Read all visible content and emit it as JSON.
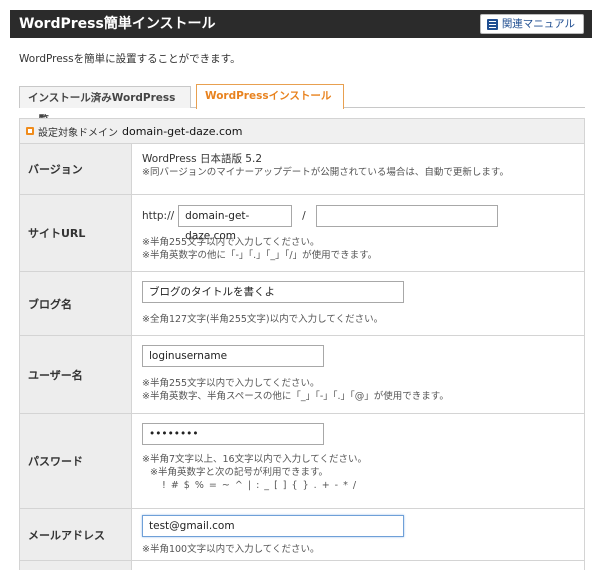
{
  "header": {
    "title": "WordPress簡単インストール",
    "manual_label": "関連マニュアル"
  },
  "lead_text": "WordPressを簡単に設置することができます。",
  "tabs": [
    {
      "label": "インストール済みWordPress一覧",
      "active": false
    },
    {
      "label": "WordPressインストール",
      "active": true
    }
  ],
  "target": {
    "label": "設定対象ドメイン",
    "domain": "domain-get-daze.com"
  },
  "form": {
    "version": {
      "label": "バージョン",
      "value": "WordPress 日本語版 5.2",
      "note": "※同バージョンのマイナーアップデートが公開されている場合は、自動で更新します。"
    },
    "site_url": {
      "label": "サイトURL",
      "prefix": "http://",
      "domain_value": "domain-get-daze.com",
      "slash": "/",
      "path_value": "",
      "note1": "※半角255文字以内で入力してください。",
      "note2": "※半角英数字の他に「-」「.」「_」「/」が使用できます。"
    },
    "blog_name": {
      "label": "ブログ名",
      "value": "ブログのタイトルを書くよ",
      "note": "※全角127文字(半角255文字)以内で入力してください。"
    },
    "username": {
      "label": "ユーザー名",
      "value": "loginusername",
      "note1": "※半角255文字以内で入力してください。",
      "note2": "※半角英数字、半角スペースの他に「_」「-」「.」「@」が使用できます。"
    },
    "password": {
      "label": "パスワード",
      "value": "••••••••",
      "note1": "※半角7文字以上、16文字以内で入力してください。",
      "note2": "※半角英数字と次の記号が利用できます。",
      "note3": "! # $ % = ~ ^ | : _ [ ] { } . + - * /"
    },
    "email": {
      "label": "メールアドレス",
      "value": "test@gmail.com",
      "note": "※半角100文字以内で入力してください。"
    }
  },
  "colors": {
    "header_bg": "#2b2b2b",
    "accent_orange": "#e8821e",
    "manual_blue": "#1f4e91",
    "label_bg": "#ededed"
  }
}
